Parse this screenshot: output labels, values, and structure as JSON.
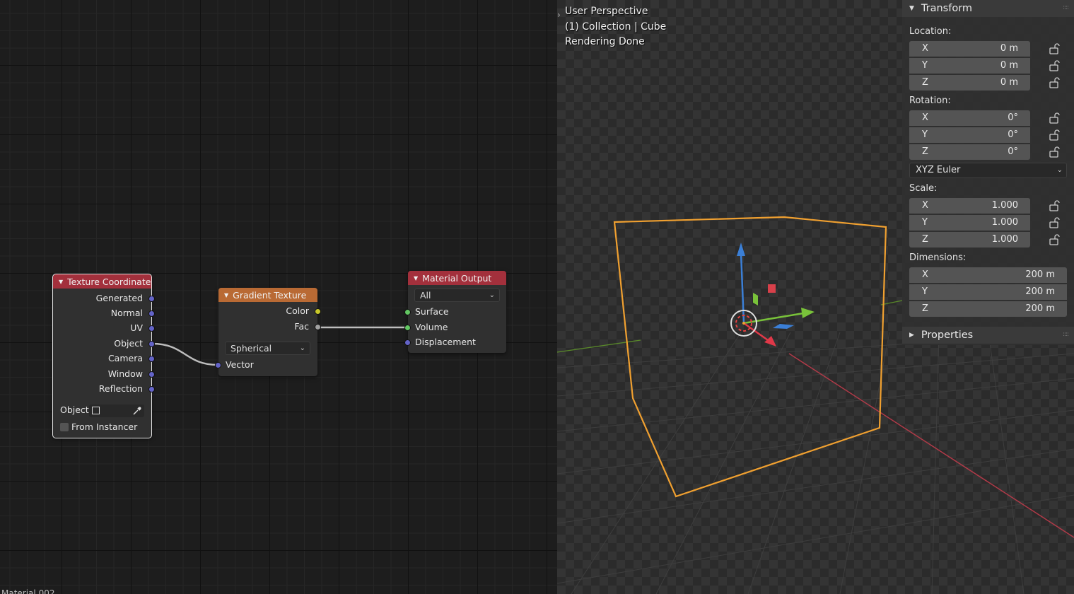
{
  "node_editor": {
    "nodes": {
      "texture_coordinate": {
        "title": "Texture Coordinate",
        "outputs": [
          "Generated",
          "Normal",
          "UV",
          "Object",
          "Camera",
          "Window",
          "Reflection"
        ],
        "object_label": "Object:",
        "from_instancer_label": "From Instancer",
        "header_color": "#a3303c"
      },
      "gradient_texture": {
        "title": "Gradient Texture",
        "outputs": [
          "Color",
          "Fac"
        ],
        "type_value": "Spherical",
        "input_vector": "Vector",
        "header_color": "#b96a34"
      },
      "material_output": {
        "title": "Material Output",
        "target_value": "All",
        "inputs": [
          "Surface",
          "Volume",
          "Displacement"
        ],
        "header_color": "#a3303c"
      }
    },
    "footer_text": "Material.002"
  },
  "viewport": {
    "overlay_lines": [
      "User Perspective",
      "(1) Collection | Cube",
      "Rendering Done"
    ],
    "selection_color": "#f0a030"
  },
  "sidebar": {
    "transform": {
      "title": "Transform",
      "location": {
        "label": "Location:",
        "x": "0 m",
        "y": "0 m",
        "z": "0 m"
      },
      "rotation": {
        "label": "Rotation:",
        "x": "0°",
        "y": "0°",
        "z": "0°",
        "mode": "XYZ Euler"
      },
      "scale": {
        "label": "Scale:",
        "x": "1.000",
        "y": "1.000",
        "z": "1.000"
      },
      "dimensions": {
        "label": "Dimensions:",
        "x": "200 m",
        "y": "200 m",
        "z": "200 m"
      },
      "axis_labels": [
        "X",
        "Y",
        "Z"
      ]
    },
    "properties": {
      "title": "Properties"
    }
  }
}
